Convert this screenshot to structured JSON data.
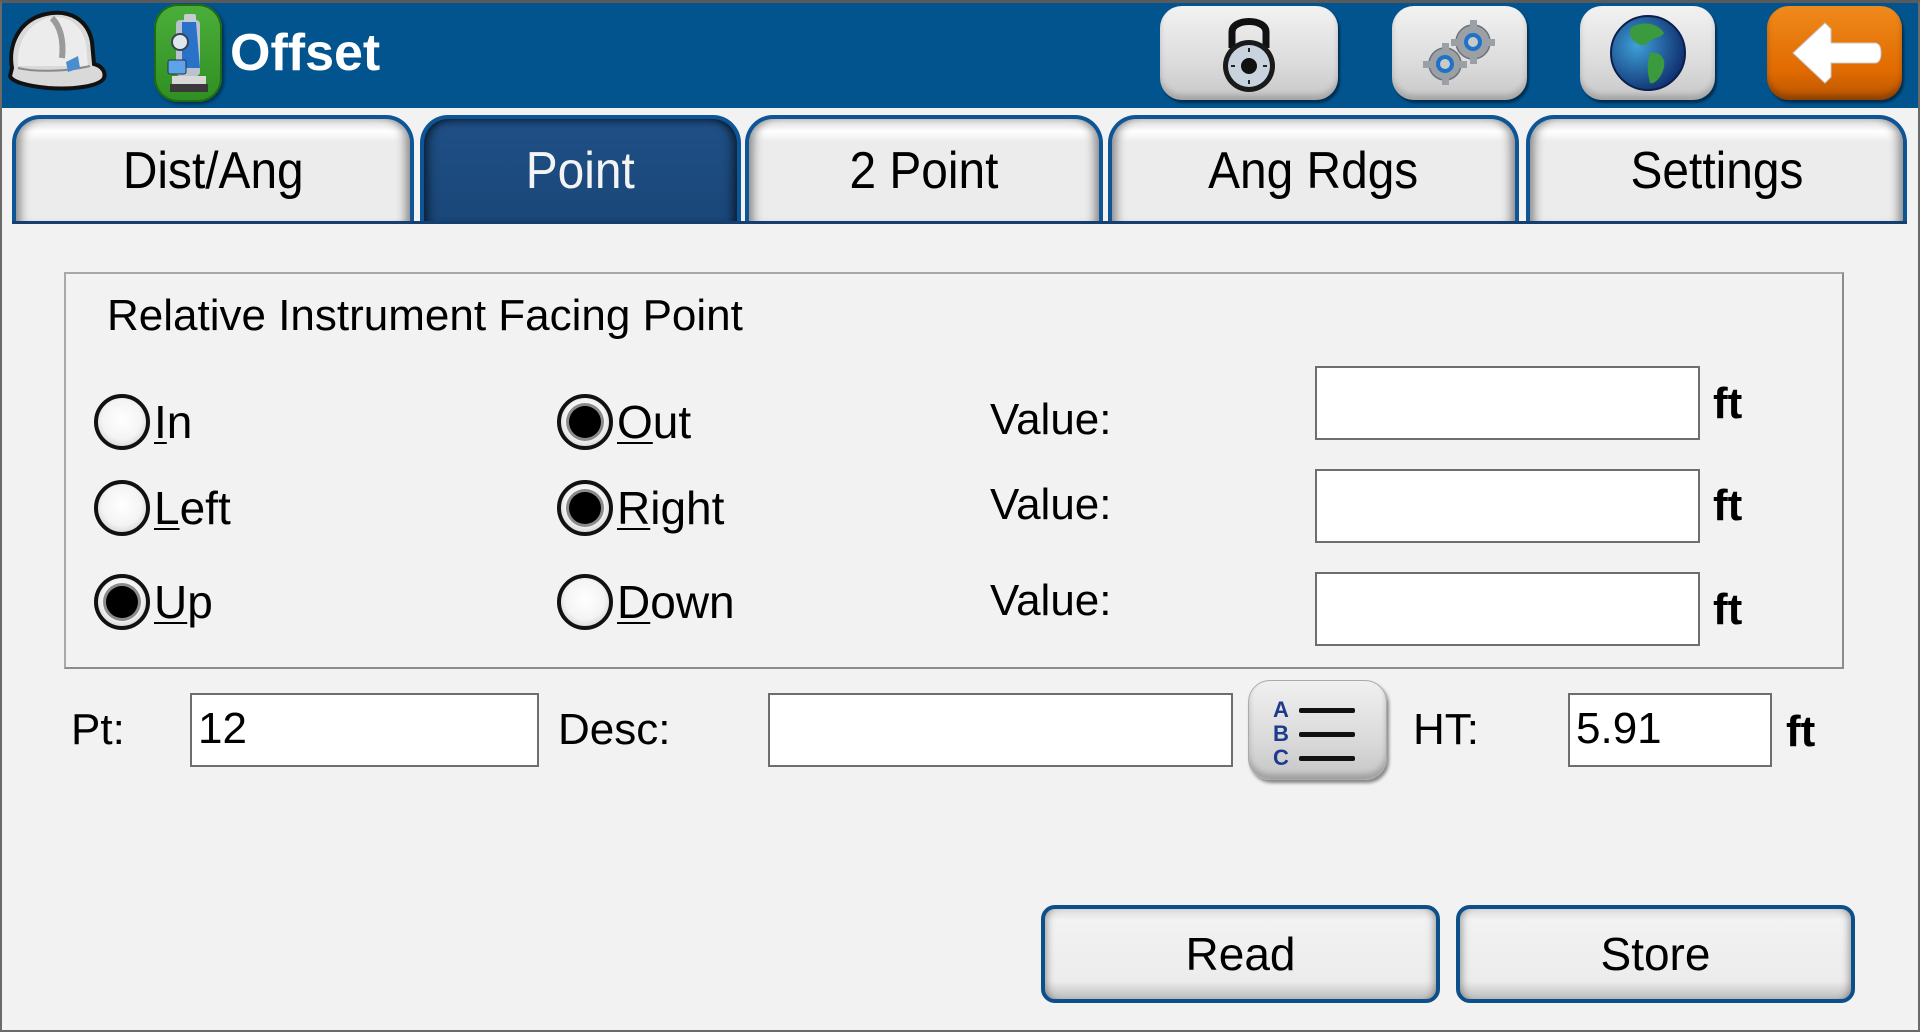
{
  "header": {
    "title": "Offset",
    "logo_icon": "hard-hat-icon",
    "app_icon": "total-station-icon",
    "buttons": [
      {
        "name": "lock",
        "icon": "padlock-icon"
      },
      {
        "name": "settings",
        "icon": "gears-icon"
      },
      {
        "name": "globe",
        "icon": "globe-icon"
      },
      {
        "name": "back",
        "icon": "back-arrow-icon"
      }
    ],
    "colors": {
      "bar": "#02548F",
      "back_button": "#E06A00",
      "app_icon_bg": "#3E9F2E"
    }
  },
  "tabs": [
    {
      "label": "Dist/Ang",
      "active": false
    },
    {
      "label": "Point",
      "active": true
    },
    {
      "label": "2 Point",
      "active": false
    },
    {
      "label": "Ang Rdgs",
      "active": false
    },
    {
      "label": "Settings",
      "active": false
    }
  ],
  "group": {
    "title": "Relative Instrument Facing Point",
    "radios": [
      {
        "label": "In",
        "mnemonic": "I",
        "rest": "n",
        "checked": false
      },
      {
        "label": "Out",
        "mnemonic": "O",
        "rest": "ut",
        "checked": true
      },
      {
        "label": "Left",
        "mnemonic": "L",
        "rest": "eft",
        "checked": false
      },
      {
        "label": "Right",
        "mnemonic": "R",
        "rest": "ight",
        "checked": true
      },
      {
        "label": "Up",
        "mnemonic": "U",
        "rest": "p",
        "checked": true
      },
      {
        "label": "Down",
        "mnemonic": "D",
        "rest": "own",
        "checked": false
      }
    ],
    "values": [
      {
        "label": "Value:",
        "value": "",
        "unit": "ft"
      },
      {
        "label": "Value:",
        "value": "",
        "unit": "ft"
      },
      {
        "label": "Value:",
        "value": "",
        "unit": "ft"
      }
    ]
  },
  "point_row": {
    "pt_label": "Pt:",
    "pt_value": "12",
    "desc_label": "Desc:",
    "desc_value": "",
    "desc_list_button_icon": "abc-list-icon",
    "abc_letters": [
      "A",
      "B",
      "C"
    ],
    "ht_label": "HT:",
    "ht_value": "5.91",
    "ht_unit": "ft"
  },
  "actions": {
    "read_label": "Read",
    "store_label": "Store"
  }
}
